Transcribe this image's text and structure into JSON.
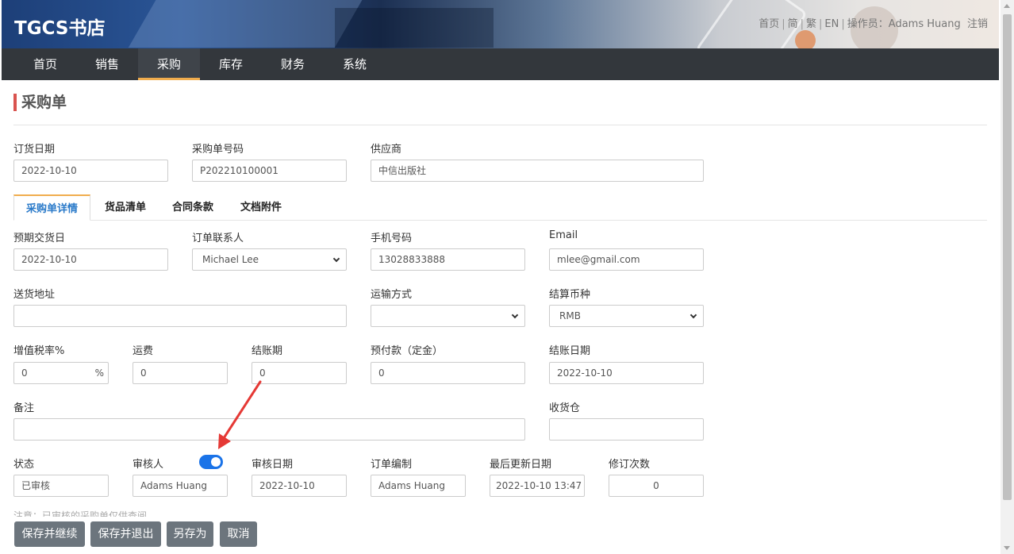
{
  "header": {
    "brand": "TGCS书店",
    "links": {
      "home": "首页",
      "simplified": "简",
      "traditional": "繁",
      "english": "EN",
      "operator_label": "操作员：",
      "operator_name": "Adams Huang",
      "logout": "注销",
      "sep": "|"
    }
  },
  "nav": {
    "items": [
      {
        "label": "首页",
        "active": false
      },
      {
        "label": "销售",
        "active": false
      },
      {
        "label": "采购",
        "active": true
      },
      {
        "label": "库存",
        "active": false
      },
      {
        "label": "财务",
        "active": false
      },
      {
        "label": "系统",
        "active": false
      }
    ]
  },
  "page": {
    "title": "采购单"
  },
  "top_fields": {
    "order_date": {
      "label": "订货日期",
      "value": "2022-10-10"
    },
    "po_number": {
      "label": "采购单号码",
      "value": "P202210100001"
    },
    "supplier": {
      "label": "供应商",
      "value": "中信出版社"
    }
  },
  "tabs": [
    {
      "label": "采购单详情",
      "active": true
    },
    {
      "label": "货品清单",
      "active": false
    },
    {
      "label": "合同条款",
      "active": false
    },
    {
      "label": "文档附件",
      "active": false
    }
  ],
  "details": {
    "expected_delivery": {
      "label": "预期交货日",
      "value": "2022-10-10"
    },
    "contact": {
      "label": "订单联系人",
      "value": "Michael Lee"
    },
    "mobile": {
      "label": "手机号码",
      "value": "13028833888"
    },
    "email": {
      "label": "Email",
      "value": "mlee@gmail.com"
    },
    "delivery_address": {
      "label": "送货地址",
      "value": ""
    },
    "shipping_method": {
      "label": "运输方式",
      "value": ""
    },
    "currency": {
      "label": "结算币种",
      "value": "RMB"
    },
    "vat_rate": {
      "label": "增值税率%",
      "value": "0",
      "suffix": "%"
    },
    "freight": {
      "label": "运费",
      "value": "0"
    },
    "payment_term": {
      "label": "结账期",
      "value": "0"
    },
    "prepayment": {
      "label": "预付款（定金）",
      "value": "0"
    },
    "settlement_date": {
      "label": "结账日期",
      "value": "2022-10-10"
    },
    "remarks": {
      "label": "备注",
      "value": ""
    },
    "warehouse": {
      "label": "收货仓",
      "value": ""
    },
    "status": {
      "label": "状态",
      "value": "已审核"
    },
    "reviewer": {
      "label": "审核人",
      "value": "Adams Huang",
      "toggle_on": true
    },
    "review_date": {
      "label": "审核日期",
      "value": "2022-10-10"
    },
    "order_editor": {
      "label": "订单编制",
      "value": "Adams Huang"
    },
    "last_updated": {
      "label": "最后更新日期",
      "value": "2022-10-10 13:47"
    },
    "revision_count": {
      "label": "修订次数",
      "value": "0"
    }
  },
  "note": "注意：已审核的采购单仅供查阅",
  "buttons": {
    "save_continue": "保存并继续",
    "save_exit": "保存并退出",
    "save_as": "另存为",
    "cancel": "取消"
  },
  "colors": {
    "nav_bg": "#33373c",
    "active_accent": "#f0ad4e",
    "title_bar": "#d9534f",
    "active_tab_text": "#2a7ac9",
    "toggle_on": "#1a73e8",
    "button_bg": "#6c757d",
    "annotation_arrow": "#e53935"
  }
}
